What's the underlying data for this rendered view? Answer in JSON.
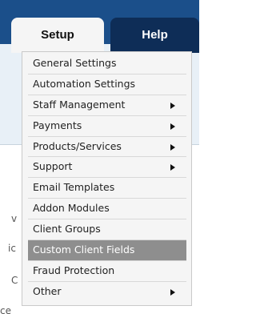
{
  "tabs": {
    "setup": "Setup",
    "help": "Help"
  },
  "background_fragments": [
    "v",
    "ic",
    "C",
    "ce"
  ],
  "menu": {
    "items": [
      {
        "label": "General Settings",
        "submenu": false,
        "active": false
      },
      {
        "label": "Automation Settings",
        "submenu": false,
        "active": false
      },
      {
        "label": "Staff Management",
        "submenu": true,
        "active": false
      },
      {
        "label": "Payments",
        "submenu": true,
        "active": false
      },
      {
        "label": "Products/Services",
        "submenu": true,
        "active": false
      },
      {
        "label": "Support",
        "submenu": true,
        "active": false
      },
      {
        "label": "Email Templates",
        "submenu": false,
        "active": false
      },
      {
        "label": "Addon Modules",
        "submenu": false,
        "active": false
      },
      {
        "label": "Client Groups",
        "submenu": false,
        "active": false
      },
      {
        "label": "Custom Client Fields",
        "submenu": false,
        "active": true
      },
      {
        "label": "Fraud Protection",
        "submenu": false,
        "active": false
      },
      {
        "label": "Other",
        "submenu": true,
        "active": false
      }
    ]
  },
  "colors": {
    "header_blue": "#1b4f8a",
    "help_tab": "#0e2d57",
    "menu_bg": "#f5f5f5",
    "active_item": "#8e8e8e"
  }
}
